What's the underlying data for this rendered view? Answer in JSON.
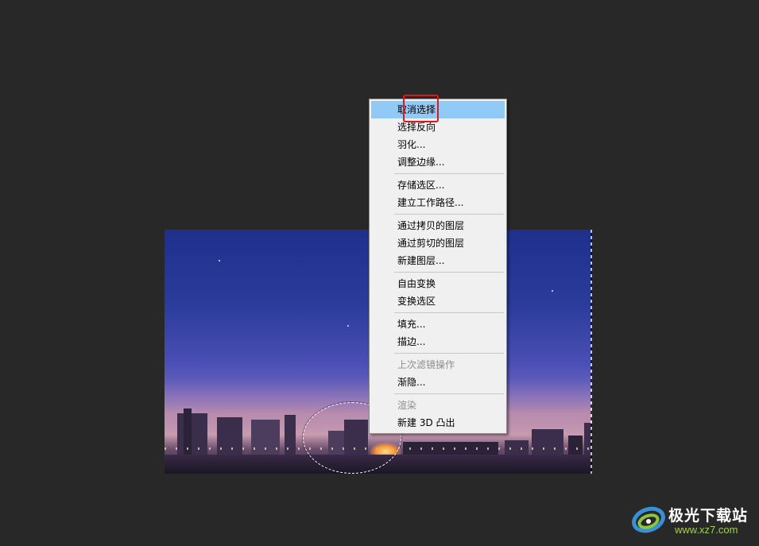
{
  "menu": {
    "items": [
      {
        "label": "取消选择",
        "state": "highlighted"
      },
      {
        "label": "选择反向",
        "state": "normal"
      },
      {
        "label": "羽化...",
        "state": "normal"
      },
      {
        "label": "调整边缘...",
        "state": "normal"
      },
      {
        "label": "存储选区...",
        "state": "normal"
      },
      {
        "label": "建立工作路径...",
        "state": "normal"
      },
      {
        "label": "通过拷贝的图层",
        "state": "normal"
      },
      {
        "label": "通过剪切的图层",
        "state": "normal"
      },
      {
        "label": "新建图层...",
        "state": "normal"
      },
      {
        "label": "自由变换",
        "state": "normal"
      },
      {
        "label": "变换选区",
        "state": "normal"
      },
      {
        "label": "填充...",
        "state": "normal"
      },
      {
        "label": "描边...",
        "state": "normal"
      },
      {
        "label": "上次滤镜操作",
        "state": "disabled"
      },
      {
        "label": "渐隐...",
        "state": "normal"
      },
      {
        "label": "渲染",
        "state": "disabled"
      },
      {
        "label": "新建 3D 凸出",
        "state": "normal"
      }
    ]
  },
  "watermark": {
    "name": "极光下载站",
    "url": "www.xz7.com"
  },
  "colors": {
    "workspace_bg": "#282828",
    "menu_bg": "#f0f0f0",
    "menu_highlight": "#91c9f7",
    "annotation_red": "#e0161a",
    "watermark_green": "#9fd24a"
  }
}
